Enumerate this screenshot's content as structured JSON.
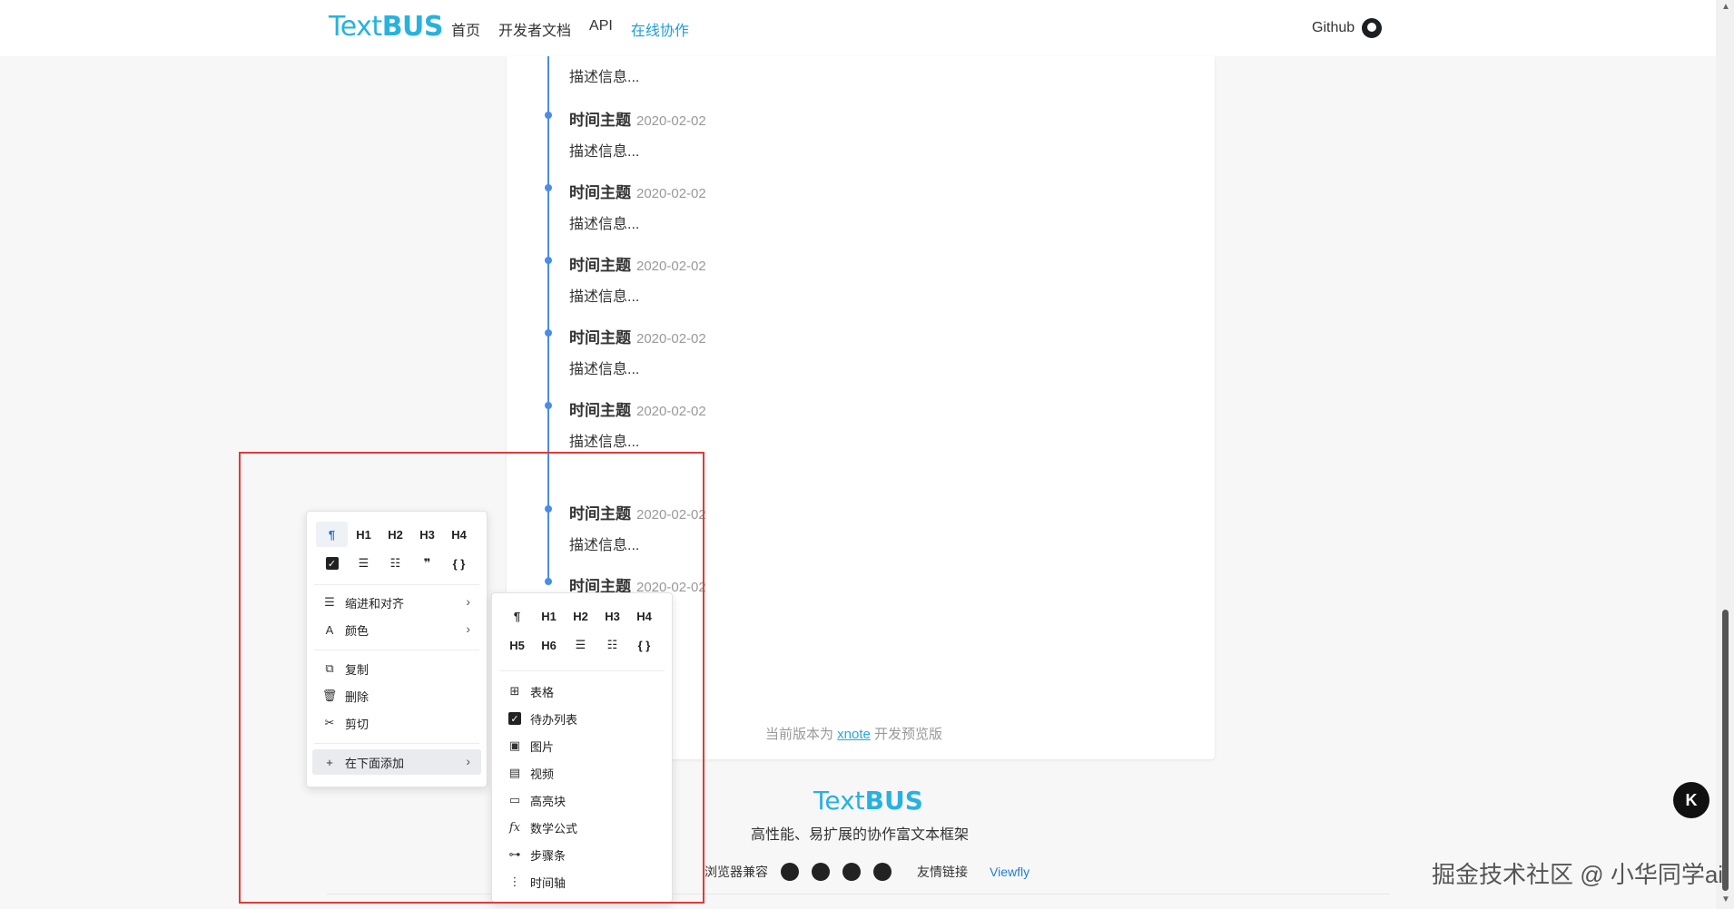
{
  "nav": {
    "logo_text": "Text",
    "logo_bold": "BUS",
    "links": [
      "首页",
      "开发者文档",
      "API",
      "在线协作"
    ],
    "github": "Github"
  },
  "timeline": {
    "top_desc": "描述信息...",
    "items": [
      {
        "title": "时间主题",
        "date": "2020-02-02",
        "desc": "描述信息..."
      },
      {
        "title": "时间主题",
        "date": "2020-02-02",
        "desc": "描述信息..."
      },
      {
        "title": "时间主题",
        "date": "2020-02-02",
        "desc": "描述信息..."
      },
      {
        "title": "时间主题",
        "date": "2020-02-02",
        "desc": "描述信息..."
      },
      {
        "title": "时间主题",
        "date": "2020-02-02",
        "desc": "描述信息..."
      },
      {
        "title": "时间主题",
        "date": "2020-02-02",
        "desc": "描述信息..."
      },
      {
        "title": "时间主题",
        "date": "2020-02-02",
        "desc": ""
      }
    ]
  },
  "version_note": {
    "prefix": "当前版本为 ",
    "link": "xnote",
    "suffix": " 开发预览版"
  },
  "footer": {
    "logo_text": "Text",
    "logo_bold": "BUS",
    "tagline": "高性能、易扩展的协作富文本框架",
    "compat_label": "浏览器兼容",
    "friend_label": "友情链接",
    "friend_link": "Viewfly"
  },
  "menu1": {
    "row1": [
      "¶",
      "H1",
      "H2",
      "H3",
      "H4"
    ],
    "row2_icons": [
      "todo-icon",
      "ordered-list-icon",
      "unordered-list-icon",
      "quote-icon",
      "code-icon"
    ],
    "items": [
      {
        "label": "缩进和对齐",
        "icon": "indent-icon",
        "submenu": true
      },
      {
        "label": "颜色",
        "icon": "font-color-icon",
        "submenu": true
      },
      {
        "label": "复制",
        "icon": "copy-icon",
        "submenu": false
      },
      {
        "label": "删除",
        "icon": "delete-icon",
        "submenu": false
      },
      {
        "label": "剪切",
        "icon": "cut-icon",
        "submenu": false
      },
      {
        "label": "在下面添加",
        "icon": "plus-icon",
        "submenu": true
      }
    ]
  },
  "menu2": {
    "row1": [
      "¶",
      "H1",
      "H2",
      "H3",
      "H4"
    ],
    "row2": [
      "H5",
      "H6"
    ],
    "items": [
      {
        "label": "表格",
        "icon": "table-icon"
      },
      {
        "label": "待办列表",
        "icon": "todo-icon"
      },
      {
        "label": "图片",
        "icon": "image-icon"
      },
      {
        "label": "视频",
        "icon": "video-icon"
      },
      {
        "label": "高亮块",
        "icon": "highlight-block-icon"
      },
      {
        "label": "数学公式",
        "icon": "formula-icon"
      },
      {
        "label": "步骤条",
        "icon": "steps-icon"
      },
      {
        "label": "时间轴",
        "icon": "timeline-icon"
      }
    ]
  },
  "watermark": "掘金技术社区 @ 小华同学ai",
  "fab_label": "K",
  "colors": {
    "brand": "#27b2e0",
    "timeline": "#4a8de8",
    "highlight_box": "#e53935"
  }
}
